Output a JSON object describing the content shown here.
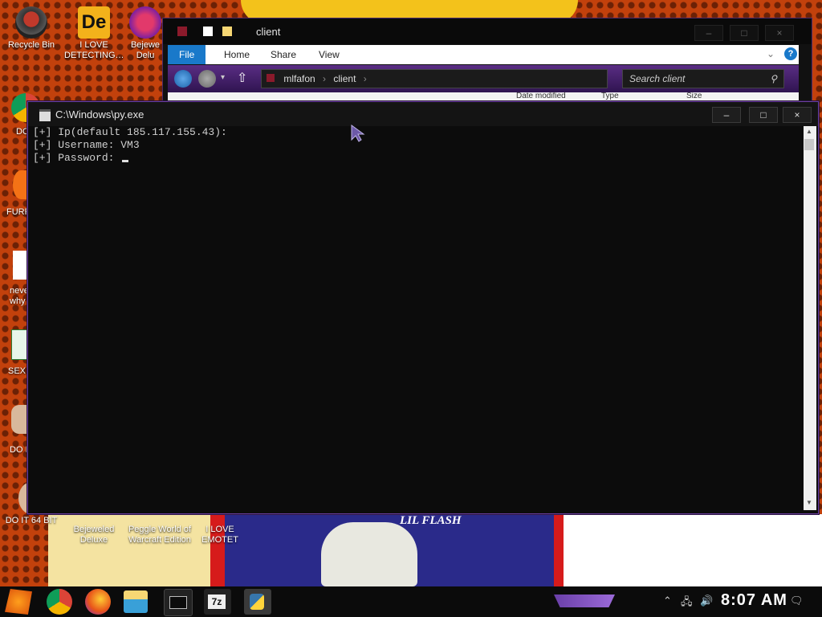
{
  "desktop": {
    "icons": [
      {
        "label": "Recycle Bin"
      },
      {
        "label": "I LOVE\nDETECTING…"
      },
      {
        "label": "Bejewe\nDelu"
      },
      {
        "label": "DO IT 64 BIT"
      },
      {
        "label": "Bejeweled\nDeluxe"
      },
      {
        "label": "Peggle World of\nWarcraft Edition"
      },
      {
        "label": "I LOVE EMOTET"
      }
    ],
    "partial_labels": [
      "DO",
      "FURF",
      "neve\nwhy",
      "SEX",
      "DO I"
    ],
    "poster_text": "LIL FLASH",
    "de_icon_text": "De"
  },
  "explorer": {
    "title": "client",
    "ribbon": {
      "file": "File",
      "home": "Home",
      "share": "Share",
      "view": "View"
    },
    "address": {
      "parts": [
        "mlfafon",
        "client"
      ]
    },
    "search_placeholder": "Search client",
    "columns": [
      "Date modified",
      "Type",
      "Size"
    ]
  },
  "console": {
    "title": "C:\\Windows\\py.exe",
    "lines": [
      "[+] Ip(default 185.117.155.43):",
      "[+] Username: VM3",
      "[+] Password: "
    ],
    "buttons": {
      "minimize": "–",
      "maximize": "□",
      "close": "×"
    }
  },
  "taskbar": {
    "clock": "8:07 AM",
    "app_labels": {
      "sevenzip": "7z"
    }
  },
  "colors": {
    "wallpaper": "#c2410c",
    "accent_purple": "#6b3fa0",
    "ribbon_file": "#1979ca"
  }
}
